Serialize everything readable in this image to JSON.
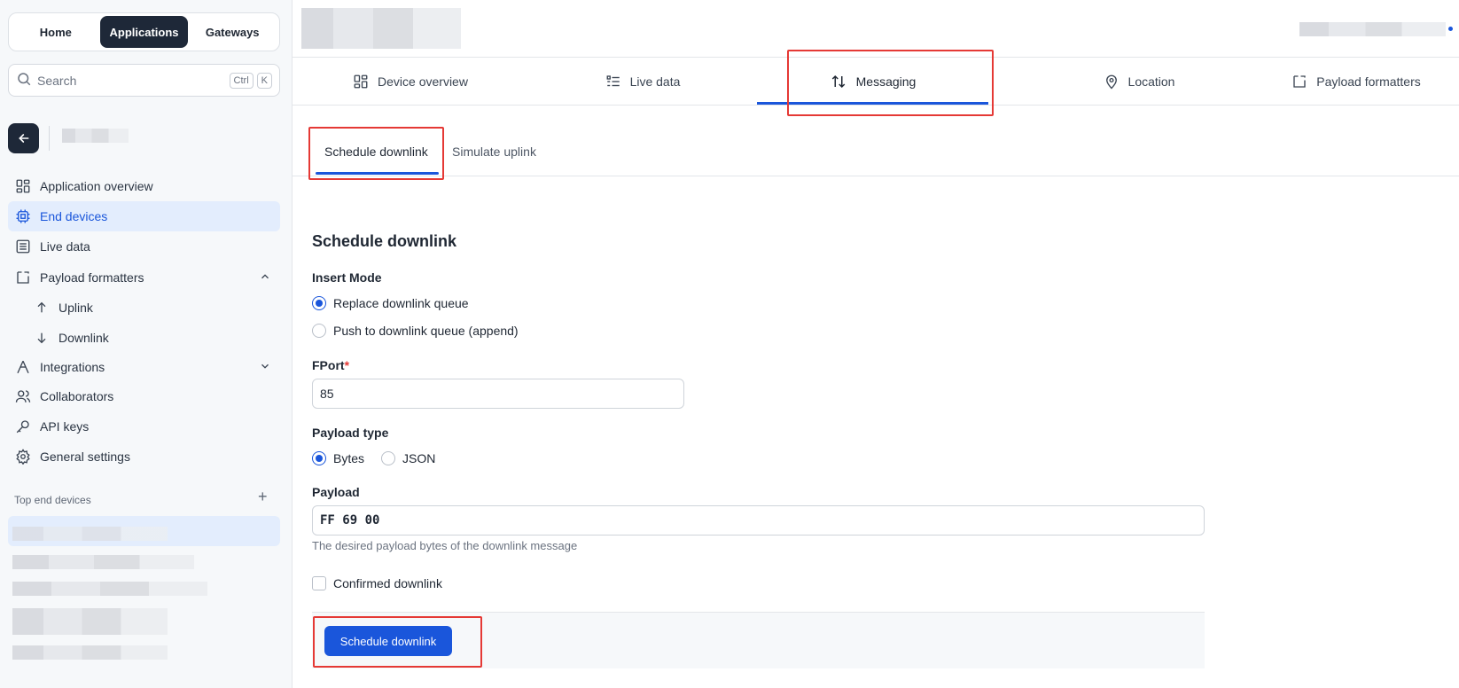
{
  "switcher": {
    "items": [
      "Home",
      "Applications",
      "Gateways"
    ],
    "active": "Applications"
  },
  "search": {
    "placeholder": "Search",
    "kbd1": "Ctrl",
    "kbd2": "K"
  },
  "sidebar": {
    "items": [
      {
        "label": "Application overview",
        "icon": "overview-icon"
      },
      {
        "label": "End devices",
        "icon": "chip-icon",
        "active": true
      },
      {
        "label": "Live data",
        "icon": "list-icon"
      },
      {
        "label": "Payload formatters",
        "icon": "formatter-icon",
        "expanded": true
      },
      {
        "label": "Uplink",
        "icon": "arrow-up-icon"
      },
      {
        "label": "Downlink",
        "icon": "arrow-down-icon"
      },
      {
        "label": "Integrations",
        "icon": "integrations-icon"
      },
      {
        "label": "Collaborators",
        "icon": "people-icon"
      },
      {
        "label": "API keys",
        "icon": "key-icon"
      },
      {
        "label": "General settings",
        "icon": "gear-icon"
      }
    ],
    "section_title": "Top end devices"
  },
  "tabs": [
    {
      "label": "Device overview",
      "icon": "overview-icon"
    },
    {
      "label": "Live data",
      "icon": "list-icon"
    },
    {
      "label": "Messaging",
      "icon": "arrows-updown-icon",
      "active": true
    },
    {
      "label": "Location",
      "icon": "location-pin-icon"
    },
    {
      "label": "Payload formatters",
      "icon": "formatter-icon"
    }
  ],
  "subtabs": [
    {
      "label": "Schedule downlink",
      "active": true
    },
    {
      "label": "Simulate uplink"
    }
  ],
  "form": {
    "title": "Schedule downlink",
    "insert_mode_label": "Insert Mode",
    "insert_mode_options": [
      "Replace downlink queue",
      "Push to downlink queue (append)"
    ],
    "insert_mode_selected": "Replace downlink queue",
    "fport_label": "FPort",
    "fport_required": "*",
    "fport_value": "85",
    "payload_type_label": "Payload type",
    "payload_type_options": [
      "Bytes",
      "JSON"
    ],
    "payload_type_selected": "Bytes",
    "payload_label": "Payload",
    "payload_value": "FF 69 00",
    "payload_helper": "The desired payload bytes of the downlink message",
    "confirmed_label": "Confirmed downlink",
    "confirmed_checked": false,
    "submit_label": "Schedule downlink"
  },
  "colors": {
    "accent": "#1a56db",
    "dark": "#1e2838",
    "highlight": "#e53935"
  }
}
